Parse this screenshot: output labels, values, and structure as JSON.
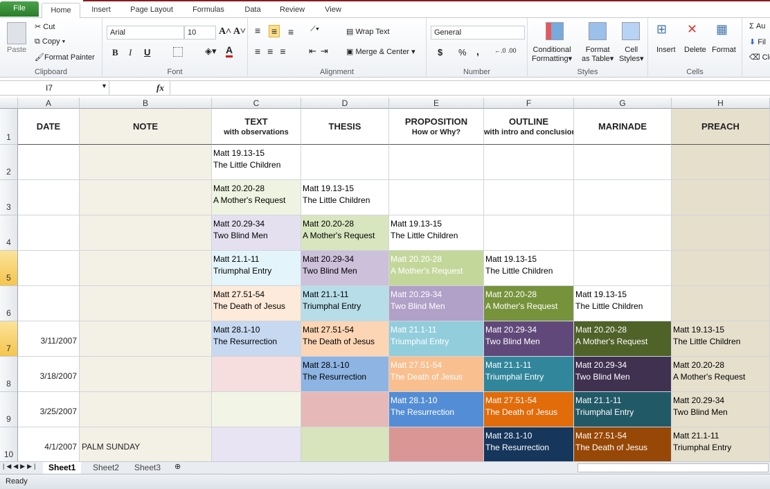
{
  "tabs": [
    "File",
    "Home",
    "Insert",
    "Page Layout",
    "Formulas",
    "Data",
    "Review",
    "View"
  ],
  "ribbon": {
    "clipboard": {
      "paste": "Paste",
      "cut": "Cut",
      "copy": "Copy",
      "format_painter": "Format Painter",
      "label": "Clipboard"
    },
    "font": {
      "name": "Arial",
      "size": "10",
      "label": "Font",
      "bold": "B",
      "italic": "I",
      "underline": "U"
    },
    "alignment": {
      "wrap_text": "Wrap Text",
      "merge_center": "Merge & Center",
      "label": "Alignment"
    },
    "number": {
      "format": "General",
      "currency": "$",
      "percent": "%",
      "comma": ",",
      "label": "Number"
    },
    "styles": {
      "conditional": [
        "Conditional",
        "Formatting"
      ],
      "format_table": [
        "Format",
        "as Table"
      ],
      "cell_styles": [
        "Cell",
        "Styles"
      ],
      "label": "Styles"
    },
    "cells": {
      "insert": "Insert",
      "delete": "Delete",
      "format": "Format",
      "label": "Cells"
    },
    "editing": {
      "autosum": "Au",
      "fill": "Fil",
      "clear": "Cle"
    }
  },
  "formula_bar": {
    "name_box": "I7",
    "fx": "fx",
    "value": ""
  },
  "columns": [
    "A",
    "B",
    "C",
    "D",
    "E",
    "F",
    "G",
    "H"
  ],
  "header_row": [
    {
      "title": "DATE",
      "sub": ""
    },
    {
      "title": "NOTE",
      "sub": ""
    },
    {
      "title": "TEXT",
      "sub": "with observations"
    },
    {
      "title": "THESIS",
      "sub": ""
    },
    {
      "title": "PROPOSITION",
      "sub": "How or Why?"
    },
    {
      "title": "OUTLINE",
      "sub": "with intro and conclusion"
    },
    {
      "title": "MARINADE",
      "sub": ""
    },
    {
      "title": "PREACH",
      "sub": ""
    }
  ],
  "rows": [
    {
      "num": "2",
      "date": "",
      "note": "",
      "cells": [
        [
          "Matt 19.13-15",
          "The Little Children",
          "#ffffff",
          "#000"
        ],
        [
          "",
          "",
          "#ffffff",
          "#000"
        ],
        [
          "",
          "",
          "#ffffff",
          "#000"
        ],
        [
          "",
          "",
          "#ffffff",
          "#000"
        ],
        [
          "",
          "",
          "#ffffff",
          "#000"
        ]
      ]
    },
    {
      "num": "3",
      "date": "",
      "note": "",
      "cells": [
        [
          "Matt 20.20-28",
          "A Mother's Request",
          "#eef4e1",
          "#000"
        ],
        [
          "Matt 19.13-15",
          "The Little Children",
          "#ffffff",
          "#000"
        ],
        [
          "",
          "",
          "#ffffff",
          "#000"
        ],
        [
          "",
          "",
          "#ffffff",
          "#000"
        ],
        [
          "",
          "",
          "#ffffff",
          "#000"
        ]
      ]
    },
    {
      "num": "4",
      "date": "",
      "note": "",
      "cells": [
        [
          "Matt 20.29-34",
          "Two Blind Men",
          "#e5e0f0",
          "#000"
        ],
        [
          "Matt 20.20-28",
          "A Mother's Request",
          "#d8e6bf",
          "#000"
        ],
        [
          "Matt 19.13-15",
          "The Little Children",
          "#ffffff",
          "#000"
        ],
        [
          "",
          "",
          "#ffffff",
          "#000"
        ],
        [
          "",
          "",
          "#ffffff",
          "#000"
        ]
      ]
    },
    {
      "num": "5",
      "date": "",
      "note": "",
      "cells": [
        [
          "Matt 21.1-11",
          "Triumphal Entry",
          "#e3f4fb",
          "#000"
        ],
        [
          "Matt 20.29-34",
          "Two Blind Men",
          "#ccc0da",
          "#000"
        ],
        [
          "Matt 20.20-28",
          "A Mother's Request",
          "#c4d79b",
          "#fff"
        ],
        [
          "Matt 19.13-15",
          "The Little Children",
          "#ffffff",
          "#000"
        ],
        [
          "",
          "",
          "#ffffff",
          "#000"
        ]
      ]
    },
    {
      "num": "6",
      "date": "",
      "note": "",
      "cells": [
        [
          "Matt 27.51-54",
          "The Death of Jesus",
          "#fdeada",
          "#000"
        ],
        [
          "Matt 21.1-11",
          "Triumphal Entry",
          "#b7dde8",
          "#000"
        ],
        [
          "Matt 20.29-34",
          "Two Blind Men",
          "#b1a0c7",
          "#fff"
        ],
        [
          "Matt 20.20-28",
          "A Mother's Request",
          "#76933c",
          "#fff"
        ],
        [
          "Matt 19.13-15",
          "The Little Children",
          "#ffffff",
          "#000"
        ]
      ]
    },
    {
      "num": "7",
      "date": "3/11/2007",
      "note": "",
      "cells": [
        [
          "Matt 28.1-10",
          "The Resurrection",
          "#c6d9f1",
          "#000"
        ],
        [
          "Matt 27.51-54",
          "The Death of Jesus",
          "#fcd5b4",
          "#000"
        ],
        [
          "Matt 21.1-11",
          "Triumphal Entry",
          "#92cddc",
          "#fff"
        ],
        [
          "Matt 20.29-34",
          "Two Blind Men",
          "#60497a",
          "#fff"
        ],
        [
          "Matt 20.20-28",
          "A Mother's Request",
          "#4f6228",
          "#fff"
        ],
        [
          "Matt 19.13-15",
          "The Little Children"
        ]
      ]
    },
    {
      "num": "8",
      "date": "3/18/2007",
      "note": "",
      "cells": [
        [
          "",
          "",
          "#f5dedd",
          "#000"
        ],
        [
          "Matt 28.1-10",
          "The Resurrection",
          "#8db4e2",
          "#000"
        ],
        [
          "Matt 27.51-54",
          "The Death of Jesus",
          "#fabf8f",
          "#fff"
        ],
        [
          "Matt 21.1-11",
          "Triumphal Entry",
          "#31869b",
          "#fff"
        ],
        [
          "Matt 20.29-34",
          "Two Blind Men",
          "#403151",
          "#fff"
        ],
        [
          "Matt 20.20-28",
          "A Mother's Request"
        ]
      ]
    },
    {
      "num": "9",
      "date": "3/25/2007",
      "note": "",
      "cells": [
        [
          "",
          "",
          "#f2f5e6",
          "#000"
        ],
        [
          "",
          "",
          "#e6b8b7",
          "#000"
        ],
        [
          "Matt 28.1-10",
          "The Resurrection",
          "#538dd5",
          "#fff"
        ],
        [
          "Matt 27.51-54",
          "The Death of Jesus",
          "#e26b0a",
          "#fff"
        ],
        [
          "Matt 21.1-11",
          "Triumphal Entry",
          "#215967",
          "#fff"
        ],
        [
          "Matt 20.29-34",
          "Two Blind Men"
        ]
      ]
    },
    {
      "num": "10",
      "date": "4/1/2007",
      "note": "PALM SUNDAY",
      "cells": [
        [
          "",
          "",
          "#e8e4f3",
          "#000"
        ],
        [
          "",
          "",
          "#d8e4bc",
          "#000"
        ],
        [
          "",
          "",
          "#da9694",
          "#000"
        ],
        [
          "Matt 28.1-10",
          "The Resurrection",
          "#16365c",
          "#fff"
        ],
        [
          "Matt 27.51-54",
          "The Death of Jesus",
          "#974706",
          "#fff"
        ],
        [
          "Matt 21.1-11",
          "Triumphal Entry"
        ]
      ]
    }
  ],
  "colors": {
    "note_column": "#f3f0e6",
    "preach_column": "#e6dfcc",
    "selected_row_header": "#f5c54e"
  },
  "sheets": [
    "Sheet1",
    "Sheet2",
    "Sheet3"
  ],
  "status": "Ready"
}
